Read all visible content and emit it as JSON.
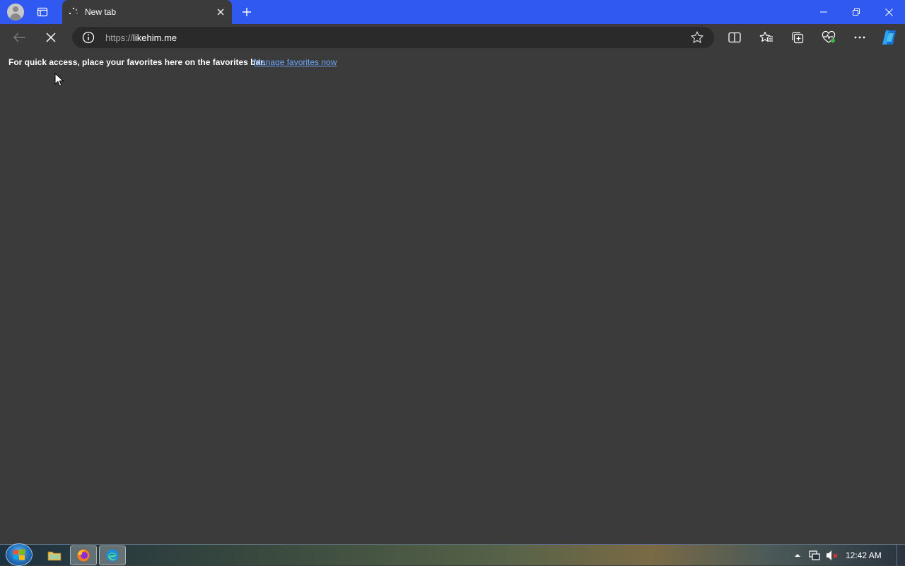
{
  "tab": {
    "title": "New tab"
  },
  "address_bar": {
    "scheme": "https://",
    "host": "likehim.me"
  },
  "favorites_bar": {
    "message": "For quick access, place your favorites here on the favorites bar.",
    "link": "Manage favorites now"
  },
  "taskbar": {
    "clock": "12:42 AM"
  },
  "colors": {
    "titlebar": "#2f59f0",
    "page_bg": "#3b3b3b",
    "link": "#6aa4f8"
  }
}
